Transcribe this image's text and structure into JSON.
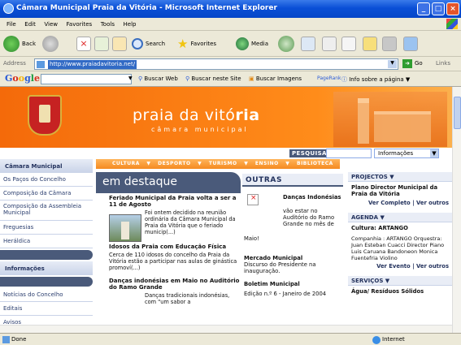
{
  "window": {
    "title": "Câmara Municipal Praia da Vitória - Microsoft Internet Explorer",
    "minimize": "_",
    "maximize": "□",
    "close": "×"
  },
  "menu": [
    "File",
    "Edit",
    "View",
    "Favorites",
    "Tools",
    "Help"
  ],
  "toolbar": {
    "back": "Back",
    "search": "Search",
    "favorites": "Favorites",
    "media": "Media"
  },
  "address": {
    "label": "Address",
    "url": "http://www.praiadavitoria.net/",
    "go": "Go",
    "links": "Links"
  },
  "googlebar": {
    "logo": "Google",
    "buscar_web": "Buscar Web",
    "buscar_site": "Buscar neste Site",
    "buscar_imagens": "Buscar Imagens",
    "pagerank": "PageRank",
    "info": "Info sobre a página"
  },
  "header": {
    "title_light": "praia da vitó",
    "title_bold": "ria",
    "subtitle": "câmara municipal"
  },
  "search": {
    "label": "PESQUISAR",
    "select": "Informações"
  },
  "sidebar": {
    "head": "Câmara Municipal",
    "items": [
      "Os Paços do Concelho",
      "Composição da Câmara",
      "Composição da Assembleia Municipal",
      "Freguesias",
      "Heráldica"
    ],
    "head2": "Informações",
    "items2": [
      "Notícias do Concelho",
      "Editais",
      "Avisos"
    ]
  },
  "nav": [
    "CULTURA",
    "DESPORTO",
    "TURISMO",
    "ENSINO",
    "BIBLIOTECA"
  ],
  "destaque": {
    "header": "em destaque",
    "news": [
      {
        "title": "Feriado Municipal da Praia volta a ser a 11 de Agosto",
        "body": "Foi ontem decidido na reunião ordinária da Câmara Municipal da Praia da Vitória que o feriado municip(...)"
      },
      {
        "title": "Idosos da Praia com Educação Física",
        "body": "Cerca de 110 idosos do concelho da Praia da Vitória estão a participar nas aulas de ginástica promoví(...)"
      },
      {
        "title": "Danças indonésias em Maio no Auditório do Ramo Grande",
        "body": "Danças tradicionais indonésias, com \"um sabor a"
      }
    ]
  },
  "outras": {
    "header": "OUTRAS",
    "item1_title": "Danças Indonésias",
    "item1_body": "vão estar no Auditório do Ramo Grande no mês de",
    "item1_tail": "Maio!",
    "item2_title": "Mercado Municipal",
    "item2_body": "Discurso do Presidente na inauguração.",
    "item3_title": "Boletim Municipal",
    "item3_body": "Edição n.º 6 - Janeiro de 2004"
  },
  "right": {
    "projectos": "PROJECTOS",
    "projectos_title": "Plano Director Municipal da Praia da Vitória",
    "ver_completo": "Ver Completo",
    "ver_outros": "Ver outros",
    "agenda": "AGENDA",
    "agenda_title": "Cultura: ARTANGO",
    "agenda_body": "Companhia : ARTANGO Orquestra: Juan Esteban Cuacci Director Piano Luis Caruana Bandoneon Monica Fuentefria Violino",
    "ver_evento": "Ver Evento",
    "servicos": "SERVIÇOS",
    "servicos_item": "Água/ Resíduos Sólidos"
  },
  "status": {
    "text": "Done",
    "zone": "Internet"
  }
}
